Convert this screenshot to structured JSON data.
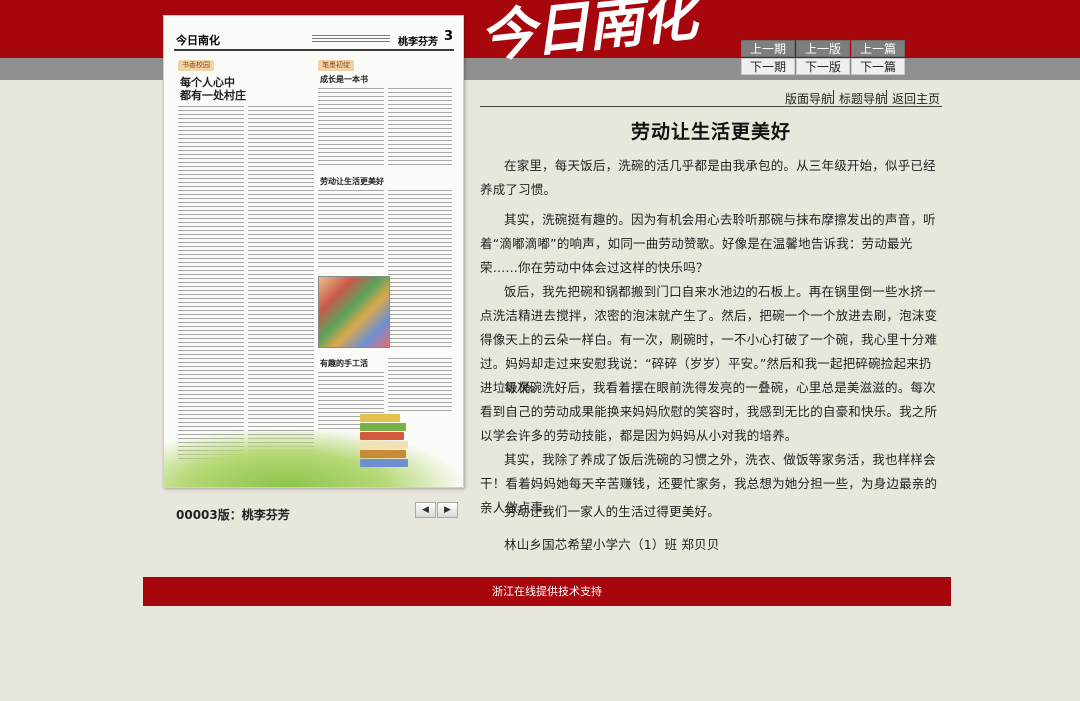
{
  "header": {
    "brand": "今日南化",
    "page_nav": {
      "prev_issue": "上一期",
      "prev_page": "上一版",
      "prev_article": "上一篇",
      "next_issue": "下一期",
      "next_page": "下一版",
      "next_article": "下一篇"
    }
  },
  "newspaper": {
    "logo": "今日南化",
    "section_name": "桃李芬芳",
    "page_number": "3",
    "tags": [
      "书香校园",
      "笔墨初绽"
    ],
    "headlines": [
      "每个人心中",
      "都有一处村庄",
      "成长是一本书",
      "劳动让生活更美好",
      "有趣的手工活"
    ]
  },
  "page_caption": "00003版：桃李芬芳",
  "page_arrows": {
    "prev": "◀",
    "next": "▶"
  },
  "links": {
    "layout_nav": "版面导航",
    "title_nav": "标题导航",
    "home": "返回主页"
  },
  "article": {
    "title": "劳动让生活更美好",
    "paragraphs": [
      "在家里，每天饭后，洗碗的活几乎都是由我承包的。从三年级开始，似乎已经养成了习惯。",
      "其实，洗碗挺有趣的。因为有机会用心去聆听那碗与抹布摩擦发出的声音，听着“滴嘟滴嘟”的响声，如同一曲劳动赞歌。好像是在温馨地告诉我：劳动最光荣……你在劳动中体会过这样的快乐吗？",
      "饭后，我先把碗和锅都搬到门口自来水池边的石板上。再在锅里倒一些水挤一点洗洁精进去搅拌，浓密的泡沫就产生了。然后，把碗一个一个放进去刷，泡沫变得像天上的云朵一样白。有一次，刷碗时，一不小心打破了一个碗，我心里十分难过。妈妈却走过来安慰我说：“碎碎（岁岁）平安。”然后和我一起把碎碗捡起来扔进垃圾桶。",
      "每次碗洗好后，我看着摆在眼前洗得发亮的一叠碗，心里总是美滋滋的。每次看到自己的劳动成果能换来妈妈欣慰的笑容时，我感到无比的自豪和快乐。我之所以学会许多的劳动技能，都是因为妈妈从小对我的培养。",
      "其实，我除了养成了饭后洗碗的习惯之外，洗衣、做饭等家务活，我也样样会干！看着妈妈她每天辛苦赚钱，还要忙家务，我总想为她分担一些，为身边最亲的亲人做点事。",
      "劳动让我们一家人的生活过得更美好。",
      "林山乡国芯希望小学六（1）班 郑贝贝"
    ]
  },
  "footer": {
    "text": "浙江在线提供技术支持"
  },
  "colors": {
    "brand_red": "#a8060d",
    "band_gray": "#8f8f8f",
    "background": "#e9e7dc"
  }
}
